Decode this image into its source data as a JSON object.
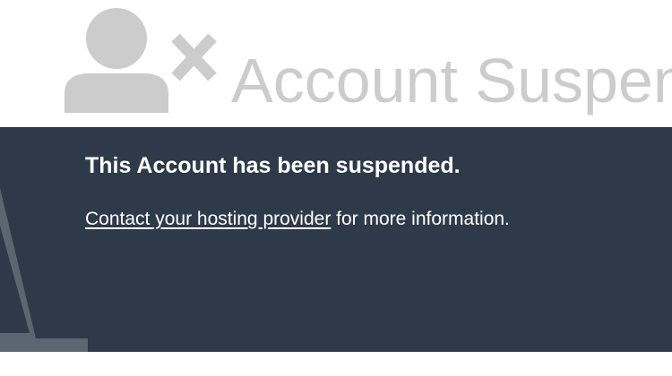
{
  "header": {
    "icon": "user-x-icon",
    "title": "Account Suspended"
  },
  "message": {
    "heading": "This Account has been suspended.",
    "link_text": "Contact your hosting provider",
    "suffix": " for more information."
  },
  "colors": {
    "header_bg": "#ffffff",
    "icon_gray": "#cccccc",
    "title_gray": "#cccccc",
    "panel_bg": "#2e3a4a",
    "triangle_gray": "#5b6673",
    "text_white": "#ffffff"
  }
}
